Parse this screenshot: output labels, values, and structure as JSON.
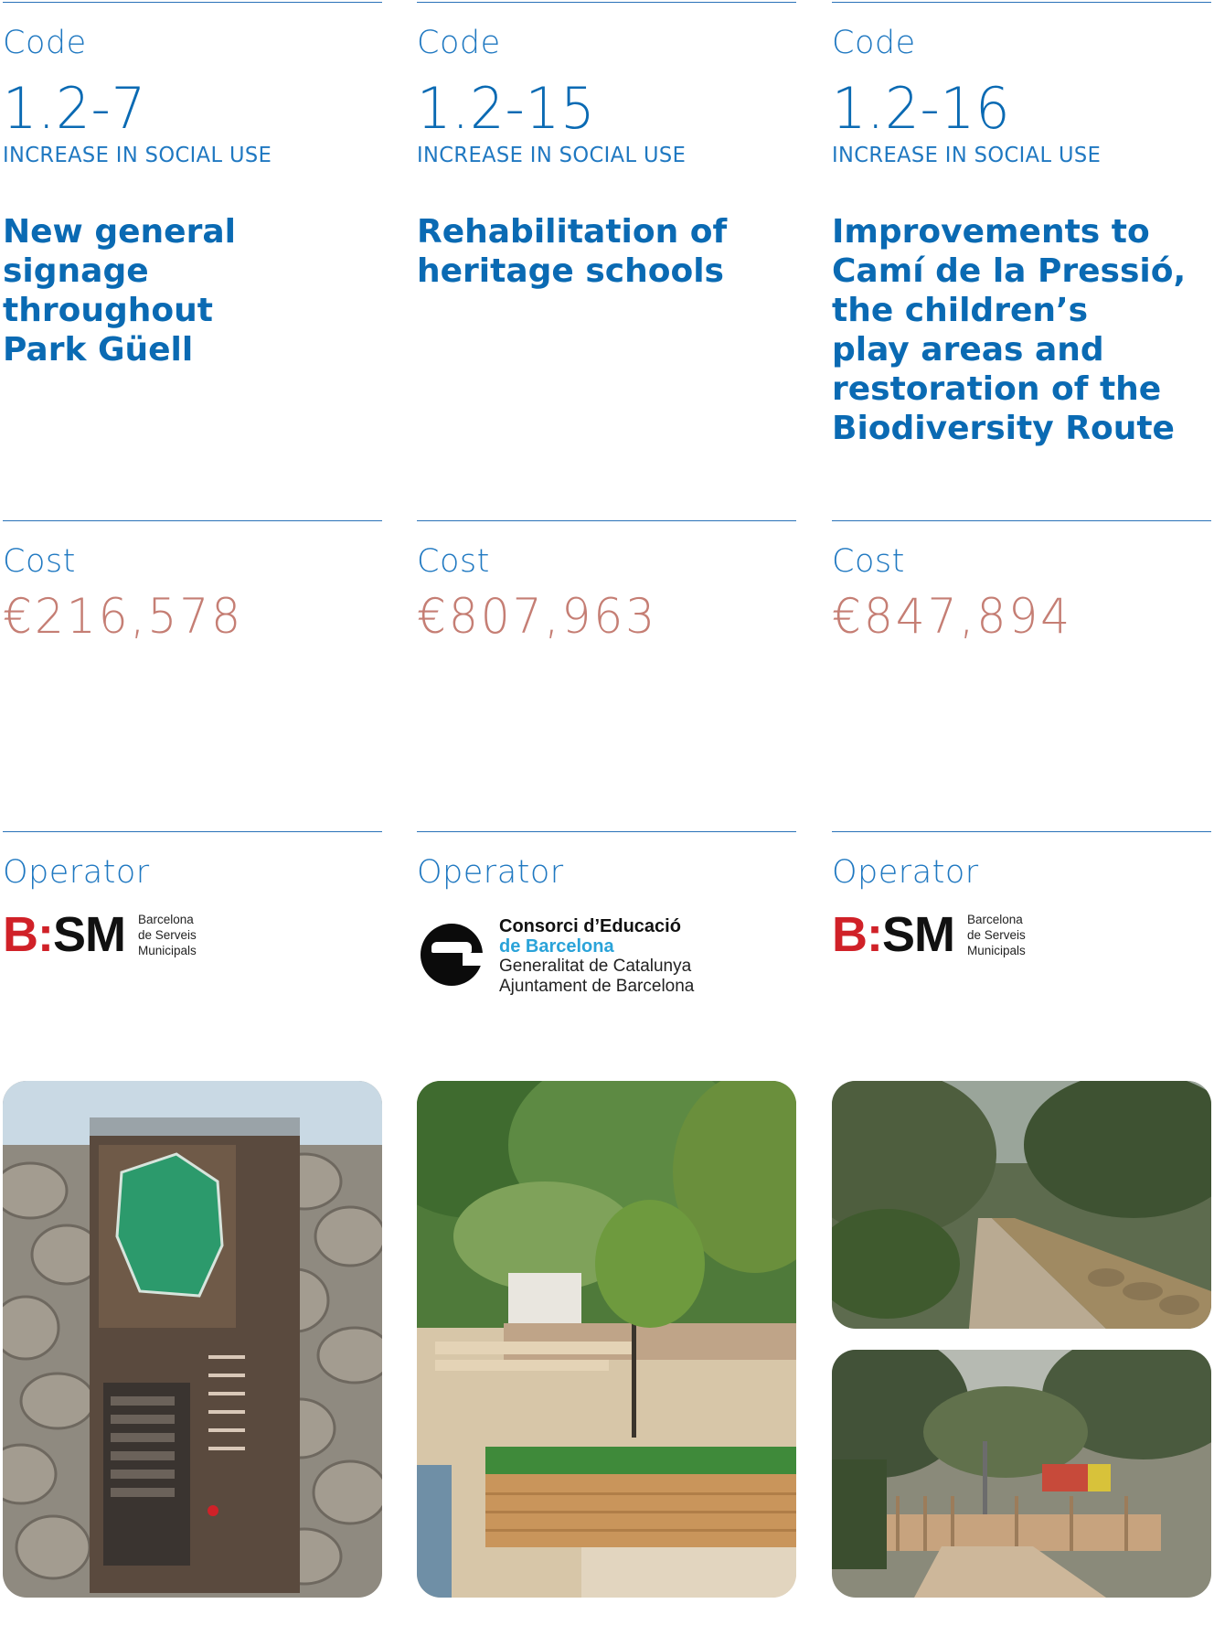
{
  "labels": {
    "code": "Code",
    "cost": "Cost",
    "operator": "Operator"
  },
  "projects": [
    {
      "code": "1.2-7",
      "category": "INCREASE IN SOCIAL USE",
      "title_lines": [
        "New general",
        "signage",
        "throughout",
        "Park Güell"
      ],
      "cost": "€216,578",
      "operator_logo": {
        "type": "bsm",
        "mark_b": "B",
        "mark_colon": ":",
        "mark_sm": "SM",
        "text_lines": [
          "Barcelona",
          "de Serveis",
          "Municipals"
        ]
      },
      "photos": [
        "signage-panel-photo"
      ]
    },
    {
      "code": "1.2-15",
      "category": "INCREASE IN SOCIAL USE",
      "title_lines": [
        "Rehabilitation of",
        "heritage schools"
      ],
      "cost": "€807,963",
      "operator_logo": {
        "type": "ceb",
        "text_lines": [
          "Consorci d’Educació",
          "de Barcelona",
          "Generalitat de Catalunya",
          "Ajuntament de Barcelona"
        ]
      },
      "photos": [
        "schoolyard-photo"
      ]
    },
    {
      "code": "1.2-16",
      "category": "INCREASE IN SOCIAL USE",
      "title_lines": [
        "Improvements to",
        "Camí de la Pressió,",
        "the children’s",
        "play areas and",
        "restoration of the",
        "Biodiversity Route"
      ],
      "cost": "€847,894",
      "operator_logo": {
        "type": "bsm",
        "mark_b": "B",
        "mark_colon": ":",
        "mark_sm": "SM",
        "text_lines": [
          "Barcelona",
          "de Serveis",
          "Municipals"
        ]
      },
      "photos": [
        "path-photo",
        "playground-photo"
      ]
    }
  ],
  "colors": {
    "blue": "#0a6ab3",
    "label_blue": "#1f78c1",
    "cost": "#c57e74",
    "bsm_red": "#d02128",
    "ceb_blue": "#2aa3d9"
  }
}
